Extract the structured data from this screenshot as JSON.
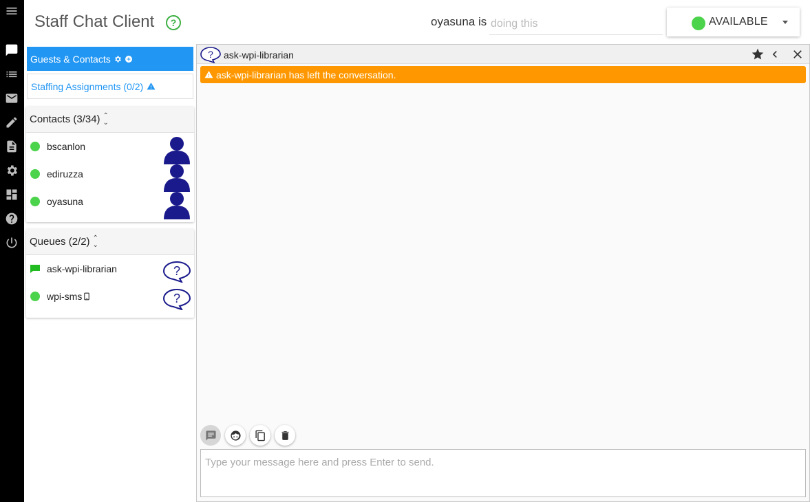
{
  "header": {
    "title": "Staff Chat Client",
    "username": "oyasuna is",
    "status_placeholder": "doing this",
    "availability": "AVAILABLE"
  },
  "nav": {
    "guests_label": "Guests & Contacts",
    "staffing_label": "Staffing Assignments (0/2)"
  },
  "contacts": {
    "header": "Contacts (3/34)",
    "items": [
      {
        "name": "bscanlon"
      },
      {
        "name": "ediruzza"
      },
      {
        "name": "oyasuna"
      }
    ]
  },
  "queues": {
    "header": "Queues (2/2)",
    "items": [
      {
        "name": "ask-wpi-librarian"
      },
      {
        "name": "wpi-sms"
      }
    ]
  },
  "chat": {
    "title": "ask-wpi-librarian",
    "alert": "ask-wpi-librarian has left the conversation.",
    "message_placeholder": "Type your message here and press Enter to send."
  },
  "colors": {
    "accent": "#2196f3",
    "available": "#4cd34c",
    "alert": "#ff9800",
    "icon_navy": "#1a1a8c"
  }
}
